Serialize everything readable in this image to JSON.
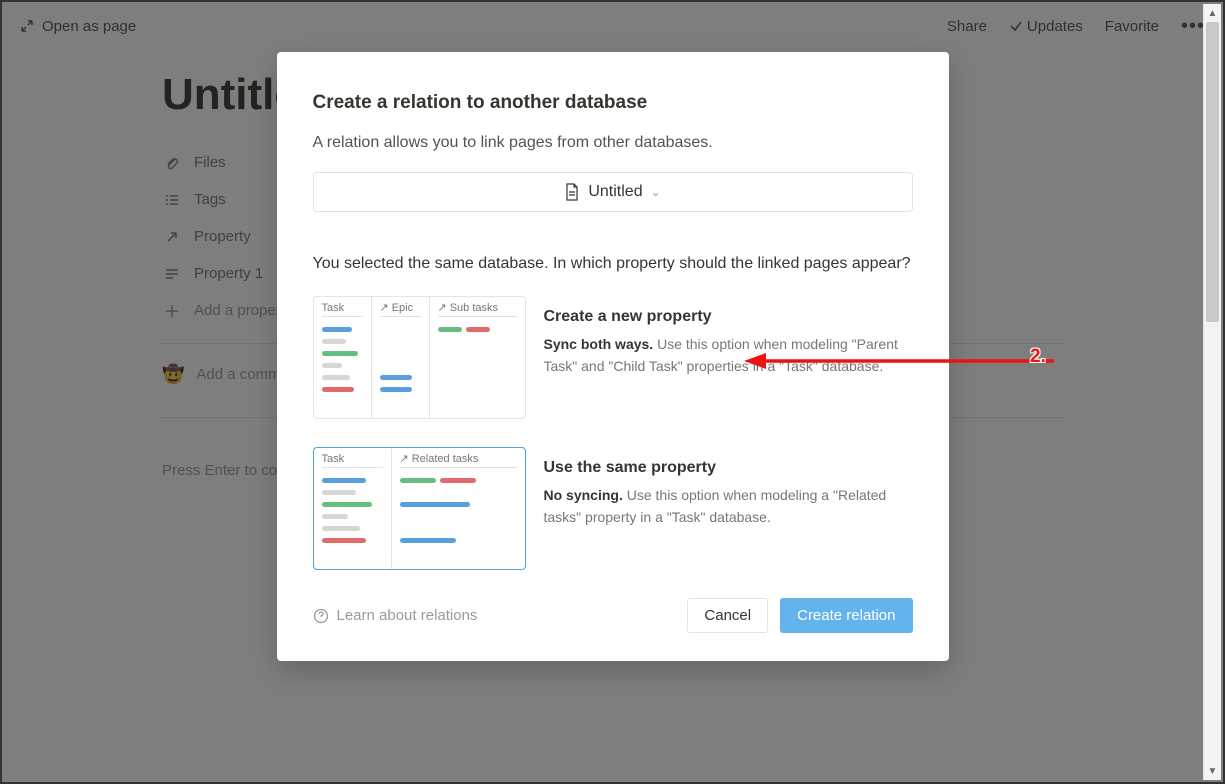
{
  "topbar": {
    "open_as_page": "Open as page",
    "share": "Share",
    "updates": "Updates",
    "favorite": "Favorite"
  },
  "page": {
    "title": "Untitled",
    "props": {
      "files": "Files",
      "tags": "Tags",
      "property": "Property",
      "property1": "Property 1",
      "add": "Add a property"
    },
    "comment_placeholder": "Add a comment...",
    "hint": "Press Enter to continue with an empty page"
  },
  "modal": {
    "title": "Create a relation to another database",
    "subtitle": "A relation allows you to link pages from other databases.",
    "selected_db": "Untitled",
    "question": "You selected the same database. In which property should the linked pages appear?",
    "option1": {
      "title": "Create a new property",
      "bold_prefix": "Sync both ways.",
      "desc": " Use this option when modeling \"Parent Task\" and \"Child Task\" properties in a \"Task\" database.",
      "thumb_headers": {
        "task": "Task",
        "epic": "Epic",
        "sub": "Sub tasks"
      }
    },
    "option2": {
      "title": "Use the same property",
      "bold_prefix": "No syncing.",
      "desc": " Use this option when modeling a \"Related tasks\" property in a \"Task\" database.",
      "thumb_headers": {
        "task": "Task",
        "related": "Related tasks"
      }
    },
    "learn": "Learn about relations",
    "cancel": "Cancel",
    "create": "Create relation"
  },
  "annotation": {
    "label": "2."
  }
}
